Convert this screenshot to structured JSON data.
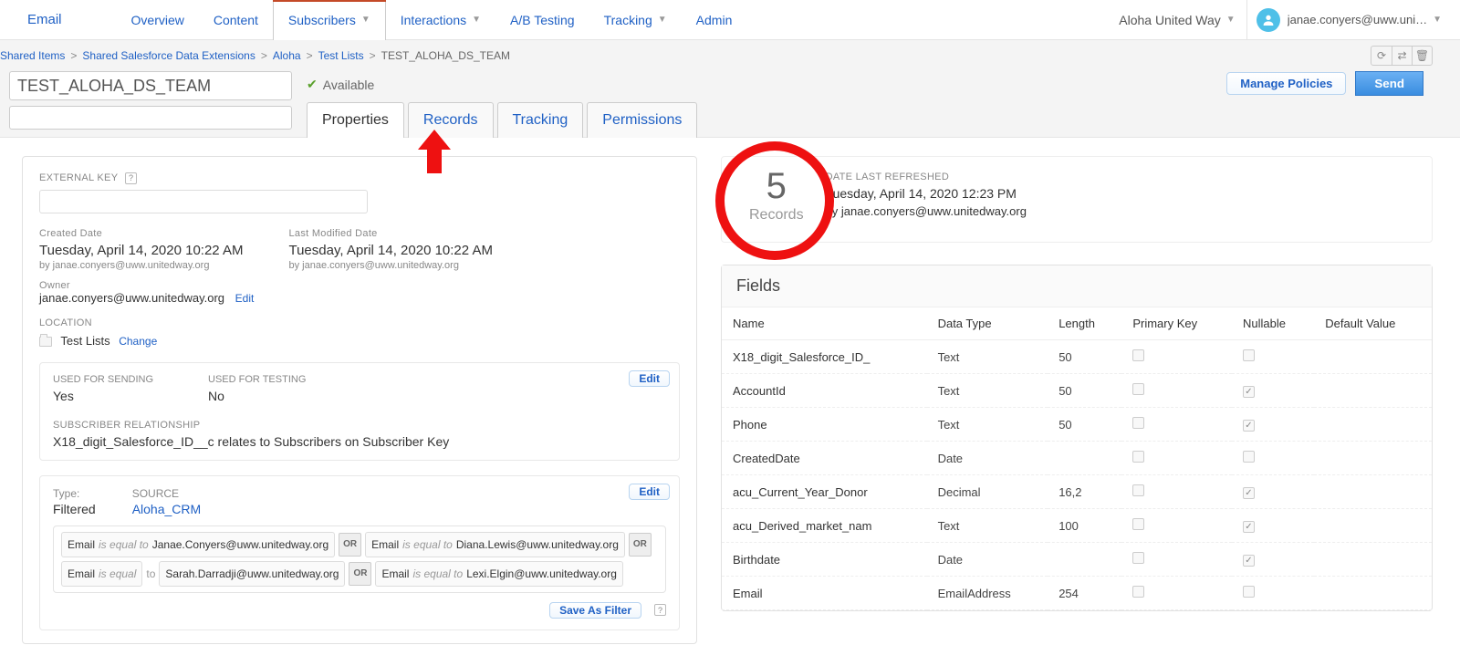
{
  "app": {
    "label": "Email"
  },
  "nav": {
    "items": [
      {
        "label": "Overview",
        "caret": false,
        "active": false
      },
      {
        "label": "Content",
        "caret": false,
        "active": false
      },
      {
        "label": "Subscribers",
        "caret": true,
        "active": true
      },
      {
        "label": "Interactions",
        "caret": true,
        "active": false
      },
      {
        "label": "A/B Testing",
        "caret": false,
        "active": false
      },
      {
        "label": "Tracking",
        "caret": true,
        "active": false
      },
      {
        "label": "Admin",
        "caret": false,
        "active": false
      }
    ]
  },
  "org": {
    "name": "Aloha United Way"
  },
  "user": {
    "email": "janae.conyers@uww.uni…"
  },
  "breadcrumb": {
    "items": [
      {
        "label": "Shared Items"
      },
      {
        "label": "Shared Salesforce Data Extensions"
      },
      {
        "label": "Aloha"
      },
      {
        "label": "Test Lists"
      }
    ],
    "current": "TEST_ALOHA_DS_TEAM"
  },
  "object_name": "TEST_ALOHA_DS_TEAM",
  "status": "Available",
  "actions": {
    "manage_policies": "Manage Policies",
    "send": "Send",
    "save_filter": "Save As Filter",
    "edit": "Edit",
    "change": "Change"
  },
  "tabs": [
    {
      "label": "Properties",
      "active": true
    },
    {
      "label": "Records",
      "active": false
    },
    {
      "label": "Tracking",
      "active": false
    },
    {
      "label": "Permissions",
      "active": false
    }
  ],
  "props": {
    "ext_key_label": "EXTERNAL KEY",
    "created_label": "Created Date",
    "created": "Tuesday, April 14, 2020 10:22 AM",
    "created_by": "by janae.conyers@uww.unitedway.org",
    "modified_label": "Last Modified Date",
    "modified": "Tuesday, April 14, 2020 10:22 AM",
    "modified_by": "by janae.conyers@uww.unitedway.org",
    "owner_label": "Owner",
    "owner": "janae.conyers@uww.unitedway.org",
    "location_label": "LOCATION",
    "location": "Test Lists",
    "used_sending_label": "USED FOR SENDING",
    "used_sending": "Yes",
    "used_testing_label": "USED FOR TESTING",
    "used_testing": "No",
    "subrel_label": "SUBSCRIBER RELATIONSHIP",
    "subrel": "X18_digit_Salesforce_ID__c relates to Subscribers on Subscriber Key",
    "type_label": "Type:",
    "type": "Filtered",
    "source_label": "SOURCE",
    "source": "Aloha_CRM"
  },
  "filters": {
    "or": "OR",
    "clauses": [
      {
        "field": "Email",
        "op": "is equal to",
        "val": "Janae.Conyers@uww.unitedway.org"
      },
      {
        "field": "Email",
        "op": "is equal to",
        "val": "Diana.Lewis@uww.unitedway.org"
      },
      {
        "field": "Email",
        "op": "is equal to",
        "val": "Sarah.Darradji@uww.unitedway.org"
      },
      {
        "field": "Email",
        "op": "is equal to",
        "val": "Lexi.Elgin@uww.unitedway.org"
      }
    ],
    "trailing_op": "is equal"
  },
  "records": {
    "count": "5",
    "count_label": "Records",
    "refresh_label": "DATE LAST REFRESHED",
    "refresh_date": "Tuesday, April 14, 2020 12:23 PM",
    "refresh_by": "by janae.conyers@uww.unitedway.org"
  },
  "fields": {
    "title": "Fields",
    "columns": [
      "Name",
      "Data Type",
      "Length",
      "Primary Key",
      "Nullable",
      "Default Value"
    ],
    "rows": [
      {
        "name": "X18_digit_Salesforce_ID_",
        "type": "Text",
        "len": "50",
        "pk": false,
        "nul": false,
        "def": ""
      },
      {
        "name": "AccountId",
        "type": "Text",
        "len": "50",
        "pk": false,
        "nul": true,
        "def": ""
      },
      {
        "name": "Phone",
        "type": "Text",
        "len": "50",
        "pk": false,
        "nul": true,
        "def": ""
      },
      {
        "name": "CreatedDate",
        "type": "Date",
        "len": "",
        "pk": false,
        "nul": false,
        "def": ""
      },
      {
        "name": "acu_Current_Year_Donor",
        "type": "Decimal",
        "len": "16,2",
        "pk": false,
        "nul": true,
        "def": ""
      },
      {
        "name": "acu_Derived_market_nam",
        "type": "Text",
        "len": "100",
        "pk": false,
        "nul": true,
        "def": ""
      },
      {
        "name": "Birthdate",
        "type": "Date",
        "len": "",
        "pk": false,
        "nul": true,
        "def": ""
      },
      {
        "name": "Email",
        "type": "EmailAddress",
        "len": "254",
        "pk": false,
        "nul": false,
        "def": ""
      }
    ]
  }
}
